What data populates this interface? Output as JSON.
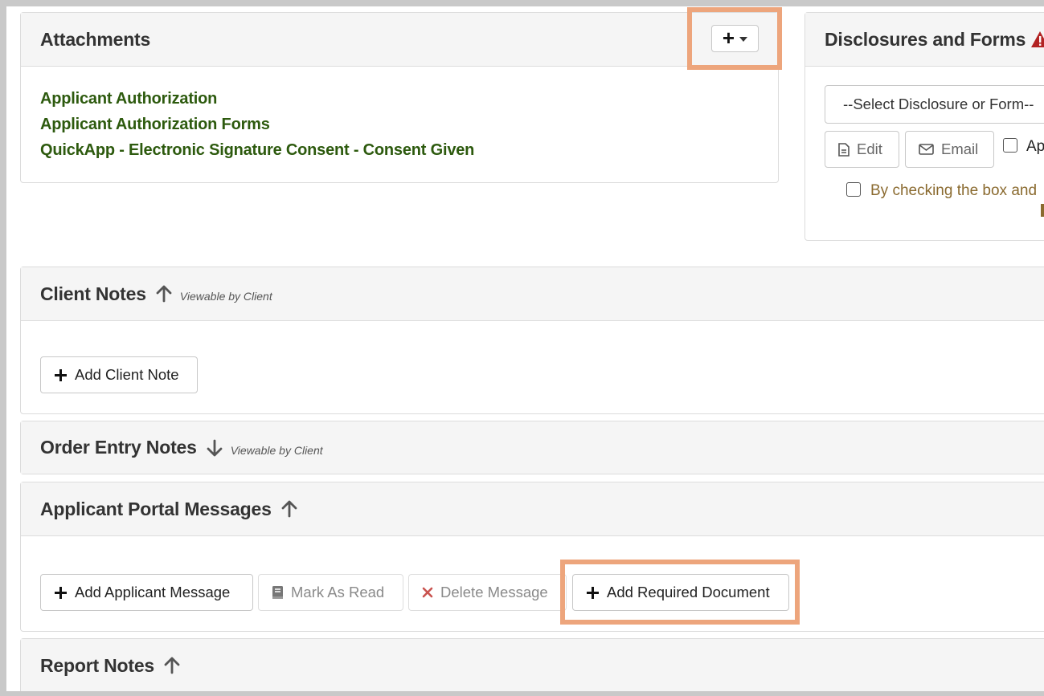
{
  "attachments": {
    "title": "Attachments",
    "add_button_label": "+",
    "links": [
      "Applicant Authorization",
      "Applicant Authorization Forms",
      "QuickApp - Electronic Signature Consent - Consent Given"
    ]
  },
  "disclosures": {
    "title": "Disclosures and Forms",
    "select_value": "--Select Disclosure or Form--",
    "edit_label": "Edit",
    "email_label": "Email",
    "checkbox_label_partial": "Ap",
    "consent_text_partial": "By checking the box and"
  },
  "client_notes": {
    "title": "Client Notes",
    "viewable": "Viewable by Client",
    "add_button": "Add Client Note"
  },
  "order_entry_notes": {
    "title": "Order Entry Notes",
    "viewable": "Viewable by Client"
  },
  "applicant_portal": {
    "title": "Applicant Portal Messages",
    "add_message": "Add Applicant Message",
    "mark_read": "Mark As Read",
    "delete_message": "Delete Message",
    "add_required_doc": "Add Required Document"
  },
  "report_notes": {
    "title": "Report Notes"
  },
  "colors": {
    "link_green": "#2d5a0e",
    "highlight": "#eda57c",
    "warning_red": "#b22222",
    "delete_red": "#c9534f"
  }
}
